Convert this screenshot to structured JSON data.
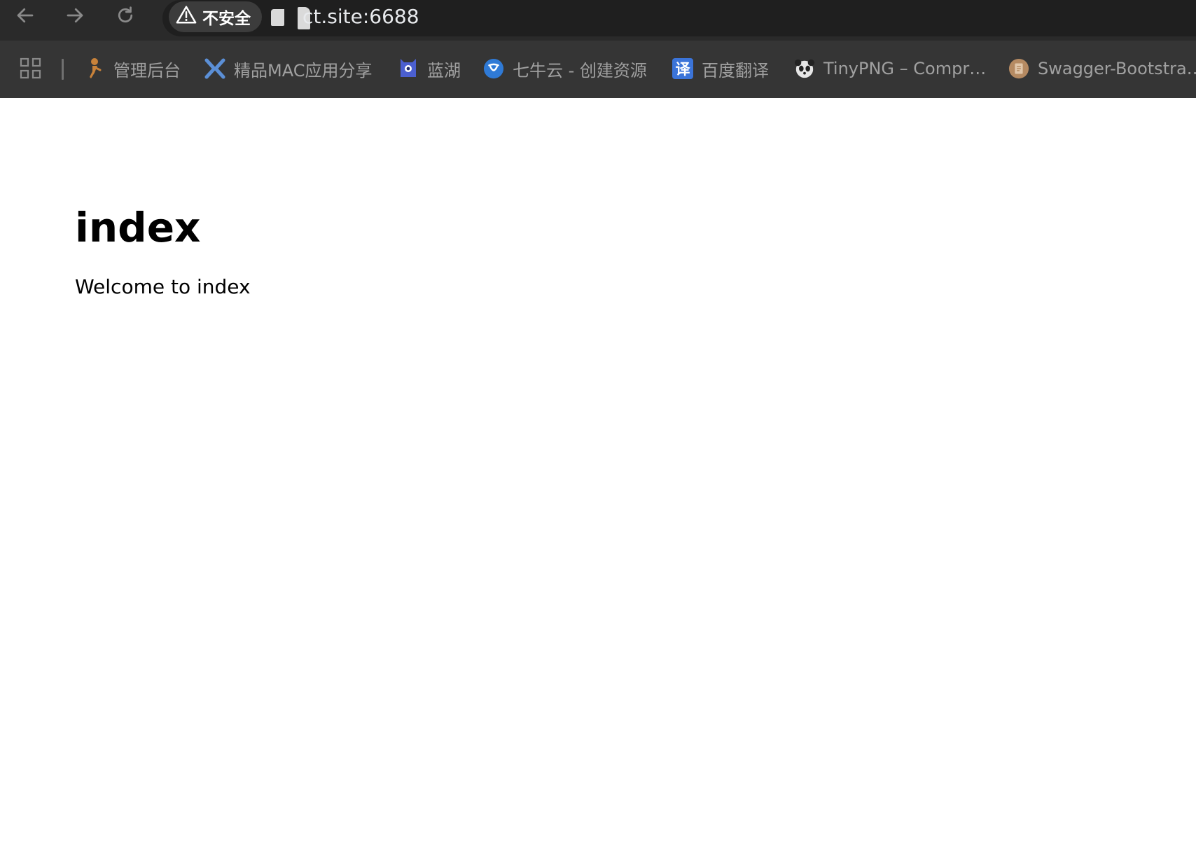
{
  "browser": {
    "security_label": "不安全",
    "url": "ct.site:6688",
    "icons": {
      "back": "arrow-left-icon",
      "forward": "arrow-right-icon",
      "reload": "reload-icon",
      "warning": "warning-triangle-icon",
      "apps": "apps-grid-icon"
    }
  },
  "bookmarks": [
    {
      "label": "管理后台",
      "icon": "bookmark-admin-icon",
      "color": "#c8823a"
    },
    {
      "label": "精品MAC应用分享",
      "icon": "bookmark-x-icon",
      "color": "#5b8fd6"
    },
    {
      "label": "蓝湖",
      "icon": "bookmark-lanhu-icon",
      "color": "#4b5fd0"
    },
    {
      "label": "七牛云 - 创建资源",
      "icon": "bookmark-qiniu-icon",
      "color": "#2f7ad6"
    },
    {
      "label": "百度翻译",
      "icon": "bookmark-baidu-translate-icon",
      "color": "#3b74d9",
      "icon_text": "译"
    },
    {
      "label": "TinyPNG – Compr…",
      "icon": "bookmark-tinypng-icon",
      "color": "#cccccc"
    },
    {
      "label": "Swagger-Bootstra…",
      "icon": "bookmark-swagger-icon",
      "color": "#b58a62"
    }
  ],
  "page": {
    "heading": "index",
    "text": "Welcome to index"
  }
}
